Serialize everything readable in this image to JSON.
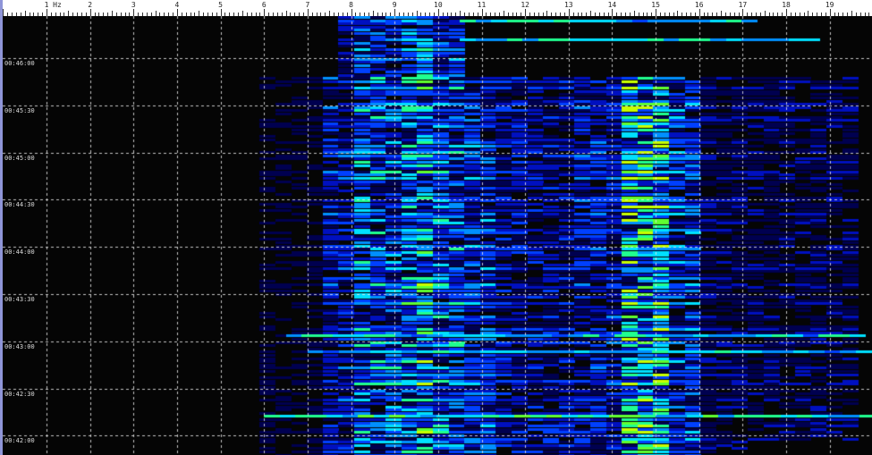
{
  "frequency_axis": {
    "unit": "Hz",
    "labels": [
      "1",
      "2",
      "3",
      "4",
      "5",
      "6",
      "7",
      "8",
      "9",
      "10",
      "11",
      "12",
      "13",
      "14",
      "15",
      "16",
      "17",
      "18",
      "19"
    ],
    "unit_label_after": "1"
  },
  "time_axis": {
    "labels": [
      "00:46:00",
      "00:45:30",
      "00:45:00",
      "00:44:30",
      "00:44:00",
      "00:43:30",
      "00:43:00",
      "00:42:30",
      "00:42:00"
    ]
  },
  "colormap": [
    "#000000",
    "#000050",
    "#0010c0",
    "#0040ff",
    "#0090ff",
    "#00e0ff",
    "#20ff90",
    "#60ff30",
    "#c8ff00"
  ],
  "spectrogram": {
    "intensity_profile_hz": [
      {
        "from": 5.9,
        "to": 7.0,
        "level": 0.12
      },
      {
        "from": 7.0,
        "to": 7.8,
        "level": 0.35
      },
      {
        "from": 7.8,
        "to": 8.8,
        "level": 0.55
      },
      {
        "from": 8.8,
        "to": 9.2,
        "level": 0.6
      },
      {
        "from": 9.2,
        "to": 9.7,
        "level": 0.72
      },
      {
        "from": 9.7,
        "to": 10.5,
        "level": 0.55
      },
      {
        "from": 10.5,
        "to": 11.2,
        "level": 0.42
      },
      {
        "from": 11.2,
        "to": 13.0,
        "level": 0.3
      },
      {
        "from": 13.0,
        "to": 14.0,
        "level": 0.35
      },
      {
        "from": 14.0,
        "to": 15.3,
        "level": 0.85
      },
      {
        "from": 15.3,
        "to": 16.0,
        "level": 0.45
      },
      {
        "from": 16.0,
        "to": 19.6,
        "level": 0.2
      }
    ],
    "strong_band_start_time": "00:46:00",
    "horizontal_lines": [
      {
        "time_offset_rows": 1,
        "from": 10.5,
        "to": 17.0,
        "level": 0.7
      },
      {
        "time_offset_rows": 7,
        "from": 10.5,
        "to": 18.5,
        "level": 0.75
      },
      {
        "time_offset_rows": 99,
        "from": 6.5,
        "to": 19.8,
        "level": 0.7
      },
      {
        "time_offset_rows": 104,
        "from": 7.0,
        "to": 19.8,
        "level": 0.65
      },
      {
        "time_offset_rows": 124,
        "from": 6.0,
        "to": 19.8,
        "level": 0.8
      }
    ]
  }
}
